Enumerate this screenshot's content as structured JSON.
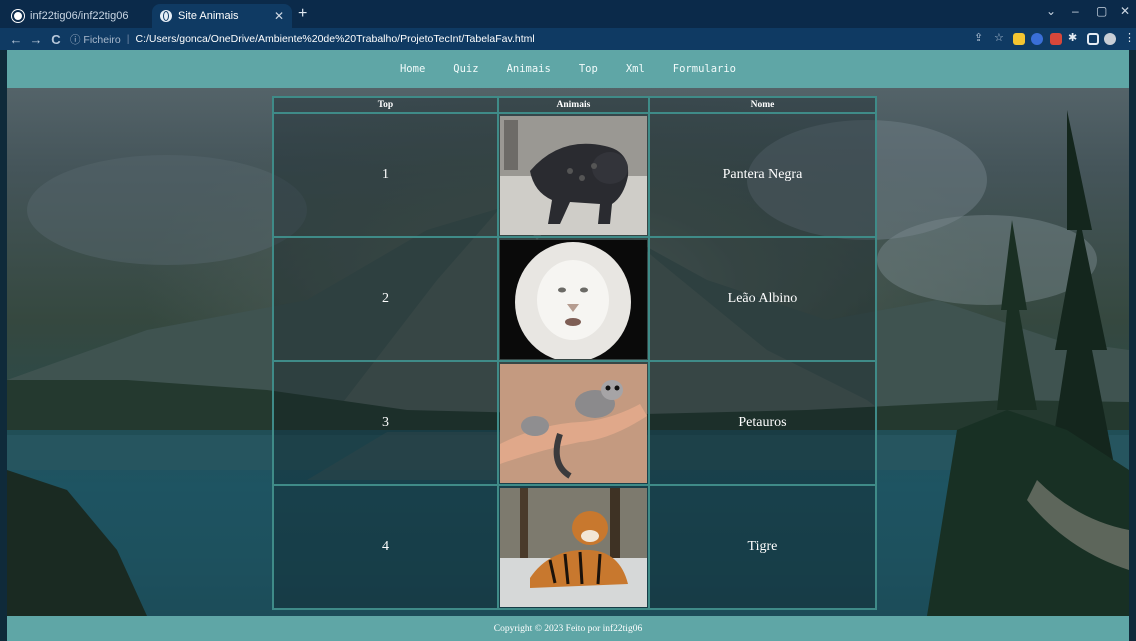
{
  "browser": {
    "tabs": [
      {
        "title": "inf22tig06/inf22tig06",
        "icon": "github-icon",
        "active": false
      },
      {
        "title": "Site Animais",
        "icon": "globe-icon",
        "active": true
      }
    ],
    "new_tab": "+",
    "window_controls": [
      "⌄",
      "–",
      "▢",
      "✕"
    ],
    "toolbar": {
      "back": "←",
      "forward": "→",
      "reload": "C",
      "info_label": "ⓘ Ficheiro",
      "separator": "|",
      "url": "C:/Users/gonca/OneDrive/Ambiente%20de%20Trabalho/ProjetoTecInt/TabelaFav.html"
    }
  },
  "nav": {
    "items": [
      "Home",
      "Quiz",
      "Animais",
      "Top",
      "Xml",
      "Formulario"
    ]
  },
  "table": {
    "headers": {
      "top": "Top",
      "animais": "Animais",
      "nome": "Nome"
    },
    "rows": [
      {
        "rank": "1",
        "name": "Pantera Negra",
        "image": "black-panther-image"
      },
      {
        "rank": "2",
        "name": "Leão Albino",
        "image": "albino-lion-image"
      },
      {
        "rank": "3",
        "name": "Petauros",
        "image": "sugar-glider-image"
      },
      {
        "rank": "4",
        "name": "Tigre",
        "image": "tiger-image"
      }
    ]
  },
  "footer": {
    "text": "Copyright © 2023 Feito por inf22tig06"
  },
  "colors": {
    "accent": "#5fa6a6",
    "table_border": "#3f8b88",
    "browser_frame": "#0f3a63"
  }
}
